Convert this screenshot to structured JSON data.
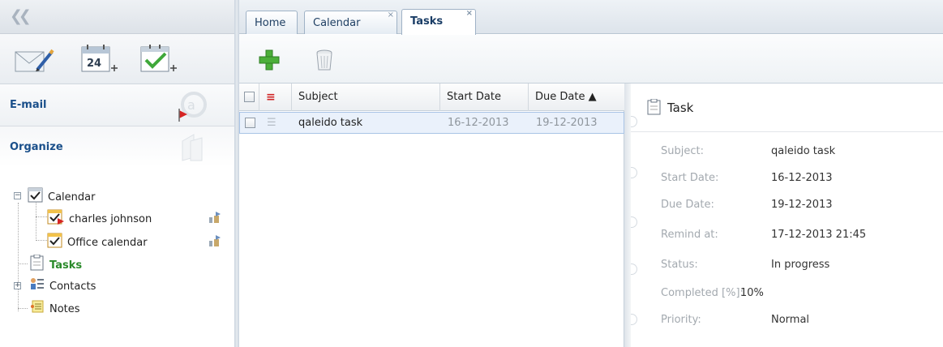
{
  "sidebar": {
    "sections": {
      "email": "E-mail",
      "organize": "Organize"
    },
    "tree": {
      "calendar": "Calendar",
      "calendar_children": [
        "charles johnson",
        "Office calendar"
      ],
      "tasks": "Tasks",
      "contacts": "Contacts",
      "notes": "Notes"
    }
  },
  "tabs": {
    "home": "Home",
    "calendar": "Calendar",
    "tasks": "Tasks",
    "close_glyph": "×"
  },
  "grid": {
    "columns": {
      "subject": "Subject",
      "start_date": "Start Date",
      "due_date": "Due Date ▲"
    },
    "rows": [
      {
        "subject": "qaleido task",
        "start_date": "16-12-2013",
        "due_date": "19-12-2013"
      }
    ]
  },
  "detail": {
    "title": "Task",
    "fields": [
      {
        "label": "Subject:",
        "value": "qaleido task"
      },
      {
        "label": "Start Date:",
        "value": "16-12-2013"
      },
      {
        "label": "Due Date:",
        "value": "19-12-2013"
      },
      {
        "label": "Remind at:",
        "value": "17-12-2013 21:45"
      },
      {
        "label": "Status:",
        "value": "In progress"
      },
      {
        "label": "Completed [%]:",
        "value": "10%"
      },
      {
        "label": "Priority:",
        "value": "Normal"
      }
    ]
  },
  "colors": {
    "accent": "#1a4f8a",
    "tasks_active": "#2a8a2a",
    "selection": "#eaf1fb"
  },
  "icons": [
    "collapse-icon",
    "mail-app-icon",
    "calendar-app-icon",
    "tasks-app-icon",
    "add-icon",
    "trash-icon",
    "task-icon"
  ]
}
